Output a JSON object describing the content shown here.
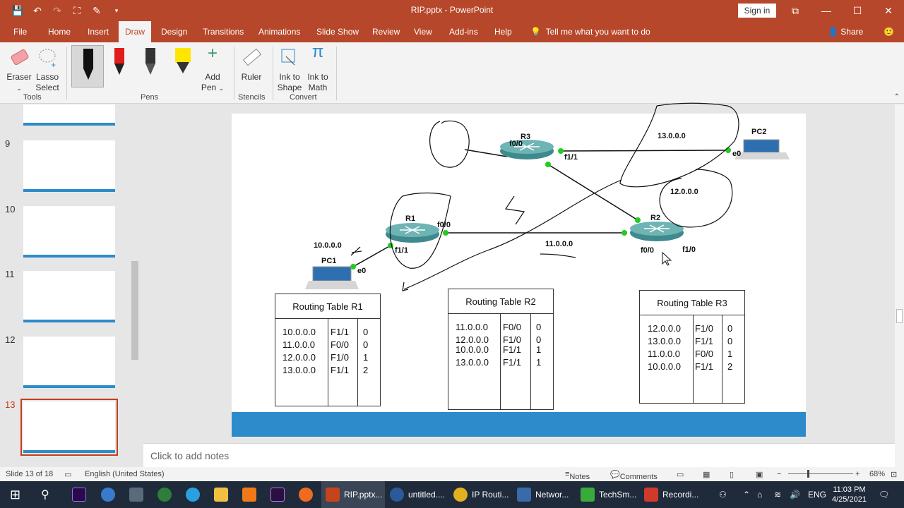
{
  "window": {
    "title": "RIP.pptx - PowerPoint",
    "sign_in": "Sign in"
  },
  "tabs": [
    "File",
    "Home",
    "Insert",
    "Draw",
    "Design",
    "Transitions",
    "Animations",
    "Slide Show",
    "Review",
    "View",
    "Add-ins",
    "Help"
  ],
  "active_tab": "Draw",
  "tell_me": "Tell me what you want to do",
  "share": "Share",
  "ribbon": {
    "eraser": "Eraser",
    "lasso1": "Lasso",
    "lasso2": "Select",
    "add_pen1": "Add",
    "add_pen2": "Pen",
    "ruler": "Ruler",
    "ink_shape1": "Ink to",
    "ink_shape2": "Shape",
    "ink_math1": "Ink to",
    "ink_math2": "Math",
    "groups": {
      "tools": "Tools",
      "pens": "Pens",
      "stencils": "Stencils",
      "convert": "Convert"
    },
    "pen_colors": [
      "#111111",
      "#e21b1b",
      "#333333",
      "#ffe600"
    ]
  },
  "thumbnails": [
    {
      "num": "9"
    },
    {
      "num": "10"
    },
    {
      "num": "11"
    },
    {
      "num": "12"
    },
    {
      "num": "13"
    }
  ],
  "slide": {
    "routers": [
      "R3",
      "R1",
      "R2"
    ],
    "pcs": [
      "PC2",
      "PC1"
    ],
    "labels": {
      "r3_f00": "f0/0",
      "r3_f11": "f1/1",
      "pc2_e0": "e0",
      "r1_f00": "f0/0",
      "r1_f11": "f1/1",
      "pc1_e0": "e0",
      "r2_f00": "f0/0",
      "r2_f10": "f1/0",
      "net13": "13.0.0.0",
      "net12": "12.0.0.0",
      "net11": "11.0.0.0",
      "net10": "10.0.0.0"
    },
    "tables": [
      {
        "title": "Routing Table  R1",
        "networks": [
          "10.0.0.0",
          "11.0.0.0",
          "12.0.0.0",
          "13.0.0.0"
        ],
        "ifaces": [
          "F1/1",
          "F0/0",
          "F1/0",
          "F1/1"
        ],
        "hops": [
          "0",
          "0",
          "1",
          "2"
        ]
      },
      {
        "title": "Routing Table R2",
        "networks": [
          "11.0.0.0",
          "12.0.0.0",
          "10.0.0.0",
          "13.0.0.0"
        ],
        "ifaces": [
          "F0/0",
          "F1/0",
          "F1/1",
          "F1/1"
        ],
        "hops": [
          "0",
          "0",
          "1",
          "1"
        ]
      },
      {
        "title": "Routing Table R3",
        "networks": [
          "12.0.0.0",
          "13.0.0.0",
          "11.0.0.0",
          "10.0.0.0"
        ],
        "ifaces": [
          "F1/0",
          "F1/1",
          "F0/0",
          "F1/1"
        ],
        "hops": [
          "0",
          "0",
          "1",
          "2"
        ]
      }
    ]
  },
  "notes_placeholder": "Click to add notes",
  "status": {
    "slide": "Slide 13 of 18",
    "language": "English (United States)",
    "notes": "Notes",
    "comments": "Comments",
    "zoom": "68%"
  },
  "taskbar": {
    "apps": [
      "RIP.pptx...",
      "untitled....",
      "IP Routi...",
      "Networ...",
      "TechSm...",
      "Recordi..."
    ],
    "lang": "ENG",
    "time": "11:03 PM",
    "date": "4/25/2021"
  }
}
